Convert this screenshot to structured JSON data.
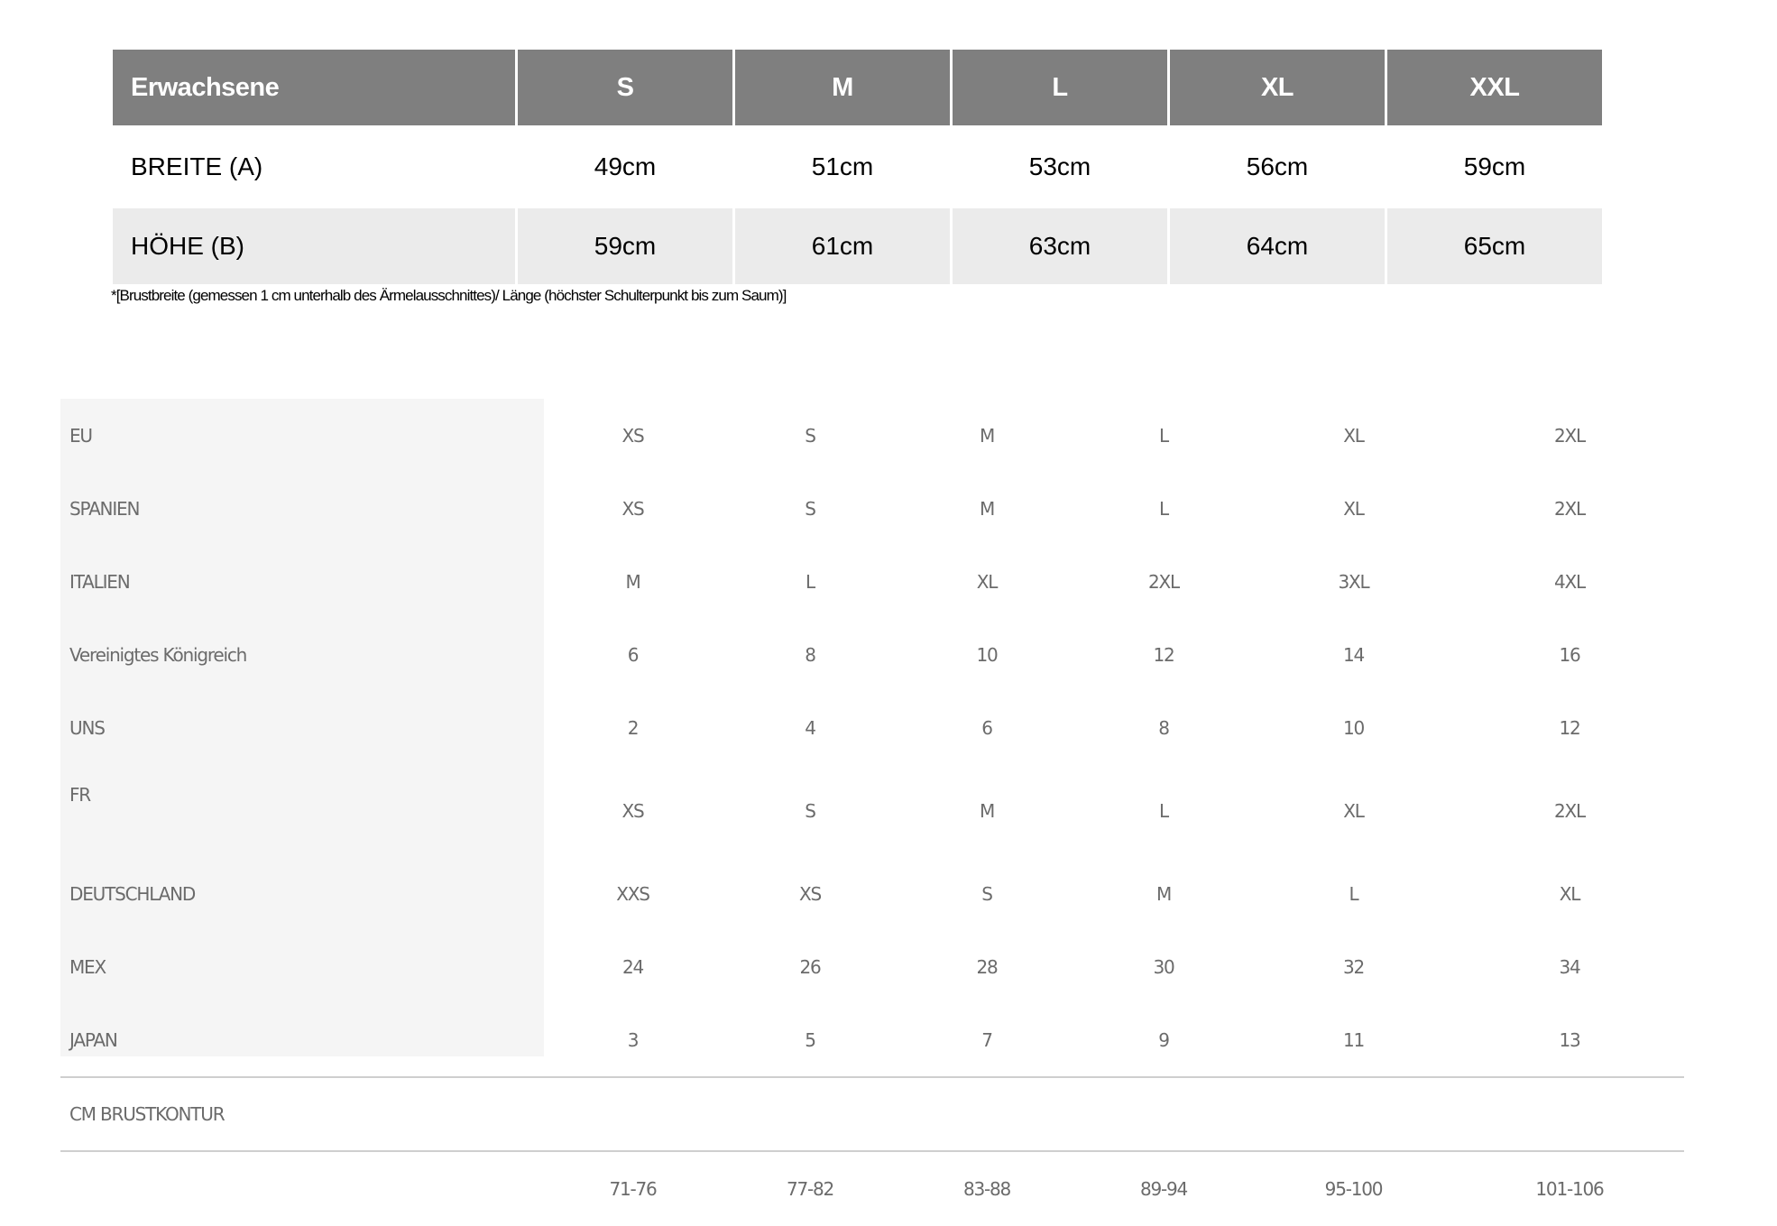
{
  "adult_table": {
    "headers": [
      "Erwachsene",
      "S",
      "M",
      "L",
      "XL",
      "XXL"
    ],
    "rows": [
      {
        "label": "BREITE (A)",
        "values": [
          "49cm",
          "51cm",
          "53cm",
          "56cm",
          "59cm"
        ]
      },
      {
        "label": "HÖHE (B)",
        "values": [
          "59cm",
          "61cm",
          "63cm",
          "64cm",
          "65cm"
        ]
      }
    ],
    "colors": {
      "header_bg": "#7f7f7f",
      "header_text": "#ffffff",
      "shaded_row": "#ebebeb"
    }
  },
  "footnote": "*[Brustbreite (gemessen 1 cm unterhalb des Ärmelausschnittes)/ Länge (höchster Schulterpunkt bis zum Saum)]",
  "conversion_table": {
    "rows": [
      {
        "label": "EU",
        "values": [
          "XS",
          "S",
          "M",
          "L",
          "XL",
          "2XL"
        ]
      },
      {
        "label": "SPANIEN",
        "values": [
          "XS",
          "S",
          "M",
          "L",
          "XL",
          "2XL"
        ]
      },
      {
        "label": "ITALIEN",
        "values": [
          "M",
          "L",
          "XL",
          "2XL",
          "3XL",
          "4XL"
        ]
      },
      {
        "label": "Vereinigtes Königreich",
        "values": [
          "6",
          "8",
          "10",
          "12",
          "14",
          "16"
        ]
      },
      {
        "label": "UNS",
        "values": [
          "2",
          "4",
          "6",
          "8",
          "10",
          "12"
        ]
      },
      {
        "label": "FR",
        "values": [
          "XS",
          "S",
          "M",
          "L",
          "XL",
          "2XL"
        ]
      },
      {
        "label": "DEUTSCHLAND",
        "values": [
          "XXS",
          "XS",
          "S",
          "M",
          "L",
          "XL"
        ]
      },
      {
        "label": "MEX",
        "values": [
          "24",
          "26",
          "28",
          "30",
          "32",
          "34"
        ]
      },
      {
        "label": "JAPAN",
        "values": [
          "3",
          "5",
          "7",
          "9",
          "11",
          "13"
        ]
      }
    ],
    "chest": {
      "label": "CM BRUSTKONTUR",
      "values": [
        "71-76",
        "77-82",
        "83-88",
        "89-94",
        "95-100",
        "101-106"
      ]
    },
    "colors": {
      "label_bg": "#f5f5f5",
      "text": "#6b6b6b",
      "rule": "#cfcfcf"
    }
  }
}
